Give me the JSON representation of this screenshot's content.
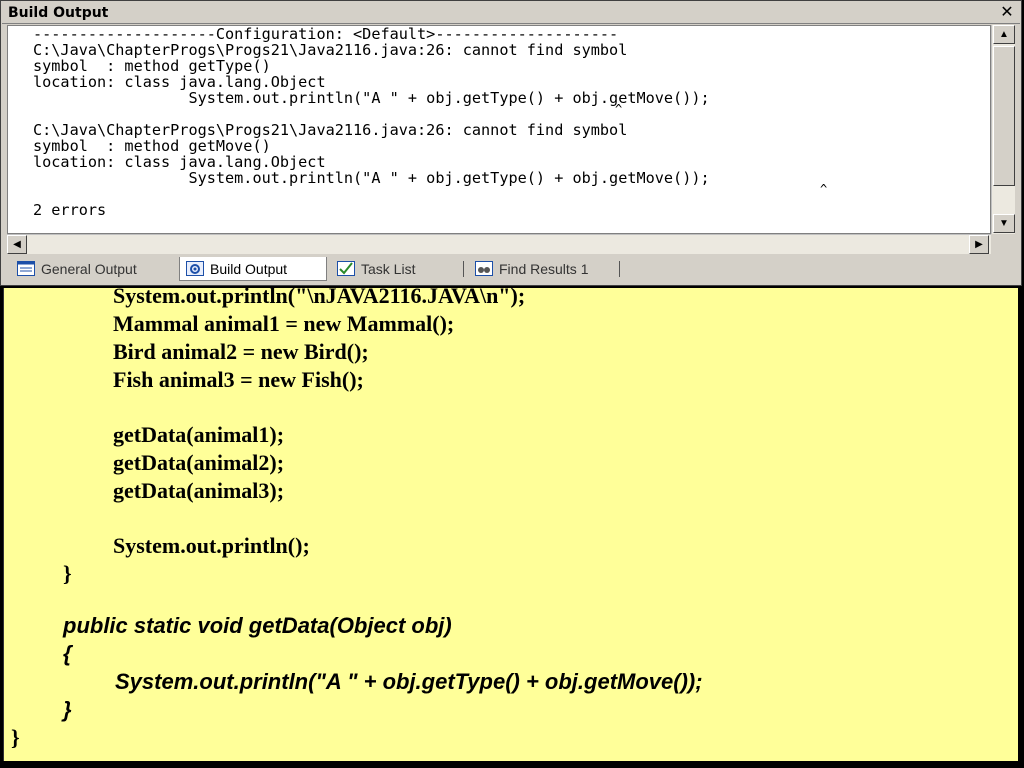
{
  "window": {
    "title": "Build Output",
    "close_glyph": "✕"
  },
  "build_output": {
    "lines": [
      "--------------------Configuration: <Default>--------------------",
      "C:\\Java\\ChapterProgs\\Progs21\\Java2116.java:26: cannot find symbol",
      "symbol  : method getType()",
      "location: class java.lang.Object",
      "                 System.out.println(\"A \" + obj.getType() + obj.getMove());",
      "C:\\Java\\ChapterProgs\\Progs21\\Java2116.java:26: cannot find symbol",
      "symbol  : method getMove()",
      "location: class java.lang.Object",
      "                 System.out.println(\"A \" + obj.getType() + obj.getMove());",
      "2 errors"
    ],
    "caret": "^"
  },
  "scrollbars": {
    "up_arrow": "▲",
    "down_arrow": "▼",
    "left_arrow": "◀",
    "right_arrow": "▶"
  },
  "tabs": [
    {
      "label": "General Output",
      "icon": "general-output-icon",
      "active": false
    },
    {
      "label": "Build Output",
      "icon": "build-output-icon",
      "active": true
    },
    {
      "label": "Task List",
      "icon": "task-list-icon",
      "active": false
    },
    {
      "label": "Find Results 1",
      "icon": "find-results-icon",
      "active": false
    }
  ],
  "code": {
    "lines": [
      "System.out.println(\"\\nJAVA2116.JAVA\\n\");",
      "Mammal animal1 = new Mammal();",
      "Bird animal2 = new Bird();",
      "Fish animal3 = new Fish();",
      "getData(animal1);",
      "getData(animal2);",
      "getData(animal3);",
      "System.out.println();",
      "}",
      "public static void getData(Object obj)",
      "{",
      "System.out.println(\"A \" + obj.getType() + obj.getMove());",
      "}",
      "}"
    ]
  },
  "colors": {
    "slide_background": "#ffff99",
    "window_chrome": "#d4d0c8"
  }
}
